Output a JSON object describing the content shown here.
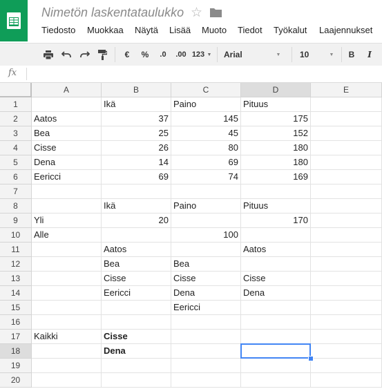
{
  "app": {
    "title": "Nimetön laskentataulukko"
  },
  "menu": [
    "Tiedosto",
    "Muokkaa",
    "Näytä",
    "Lisää",
    "Muoto",
    "Tiedot",
    "Työkalut",
    "Laajennukset"
  ],
  "toolbar": {
    "currency": "€",
    "percent": "%",
    "dec_decrease": ".0",
    "dec_increase": ".00",
    "format_more": "123",
    "font": "Arial",
    "size": "10",
    "bold": "B",
    "italic": "I"
  },
  "formula_bar": {
    "fx_label": "fx",
    "value": ""
  },
  "columns": [
    "A",
    "B",
    "C",
    "D",
    "E"
  ],
  "rows": [
    "1",
    "2",
    "3",
    "4",
    "5",
    "6",
    "7",
    "8",
    "9",
    "10",
    "11",
    "12",
    "13",
    "14",
    "15",
    "16",
    "17",
    "18",
    "19",
    "20"
  ],
  "selected": {
    "cell": "D18",
    "column": "D",
    "row": "18"
  },
  "cells": [
    [
      "",
      "Ikä",
      "Paino",
      "Pituus",
      ""
    ],
    [
      "Aatos",
      "37",
      "145",
      "175",
      ""
    ],
    [
      "Bea",
      "25",
      "45",
      "152",
      ""
    ],
    [
      "Cisse",
      "26",
      "80",
      "180",
      ""
    ],
    [
      "Dena",
      "14",
      "69",
      "180",
      ""
    ],
    [
      "Eericci",
      "69",
      "74",
      "169",
      ""
    ],
    [
      "",
      "",
      "",
      "",
      ""
    ],
    [
      "",
      "Ikä",
      "Paino",
      "Pituus",
      ""
    ],
    [
      "Yli",
      "20",
      "",
      "170",
      ""
    ],
    [
      "Alle",
      "",
      "100",
      "",
      ""
    ],
    [
      "",
      "Aatos",
      "",
      "Aatos",
      ""
    ],
    [
      "",
      "Bea",
      "Bea",
      "",
      ""
    ],
    [
      "",
      "Cisse",
      "Cisse",
      "Cisse",
      ""
    ],
    [
      "",
      "Eericci",
      "Dena",
      "Dena",
      ""
    ],
    [
      "",
      "",
      "Eericci",
      "",
      ""
    ],
    [
      "",
      "",
      "",
      "",
      ""
    ],
    [
      "Kaikki",
      "Cisse",
      "",
      "",
      ""
    ],
    [
      "",
      "Dena",
      "",
      "",
      ""
    ],
    [
      "",
      "",
      "",
      "",
      ""
    ],
    [
      "",
      "",
      "",
      "",
      ""
    ]
  ],
  "numeric_cells": [
    "B2",
    "C2",
    "D2",
    "B3",
    "C3",
    "D3",
    "B4",
    "C4",
    "D4",
    "B5",
    "C5",
    "D5",
    "B6",
    "C6",
    "D6",
    "B9",
    "D9",
    "C10"
  ],
  "bold_cells": [
    "B17",
    "B18"
  ],
  "colors": {
    "brand": "#0f9d58",
    "selection": "#4285f4"
  }
}
